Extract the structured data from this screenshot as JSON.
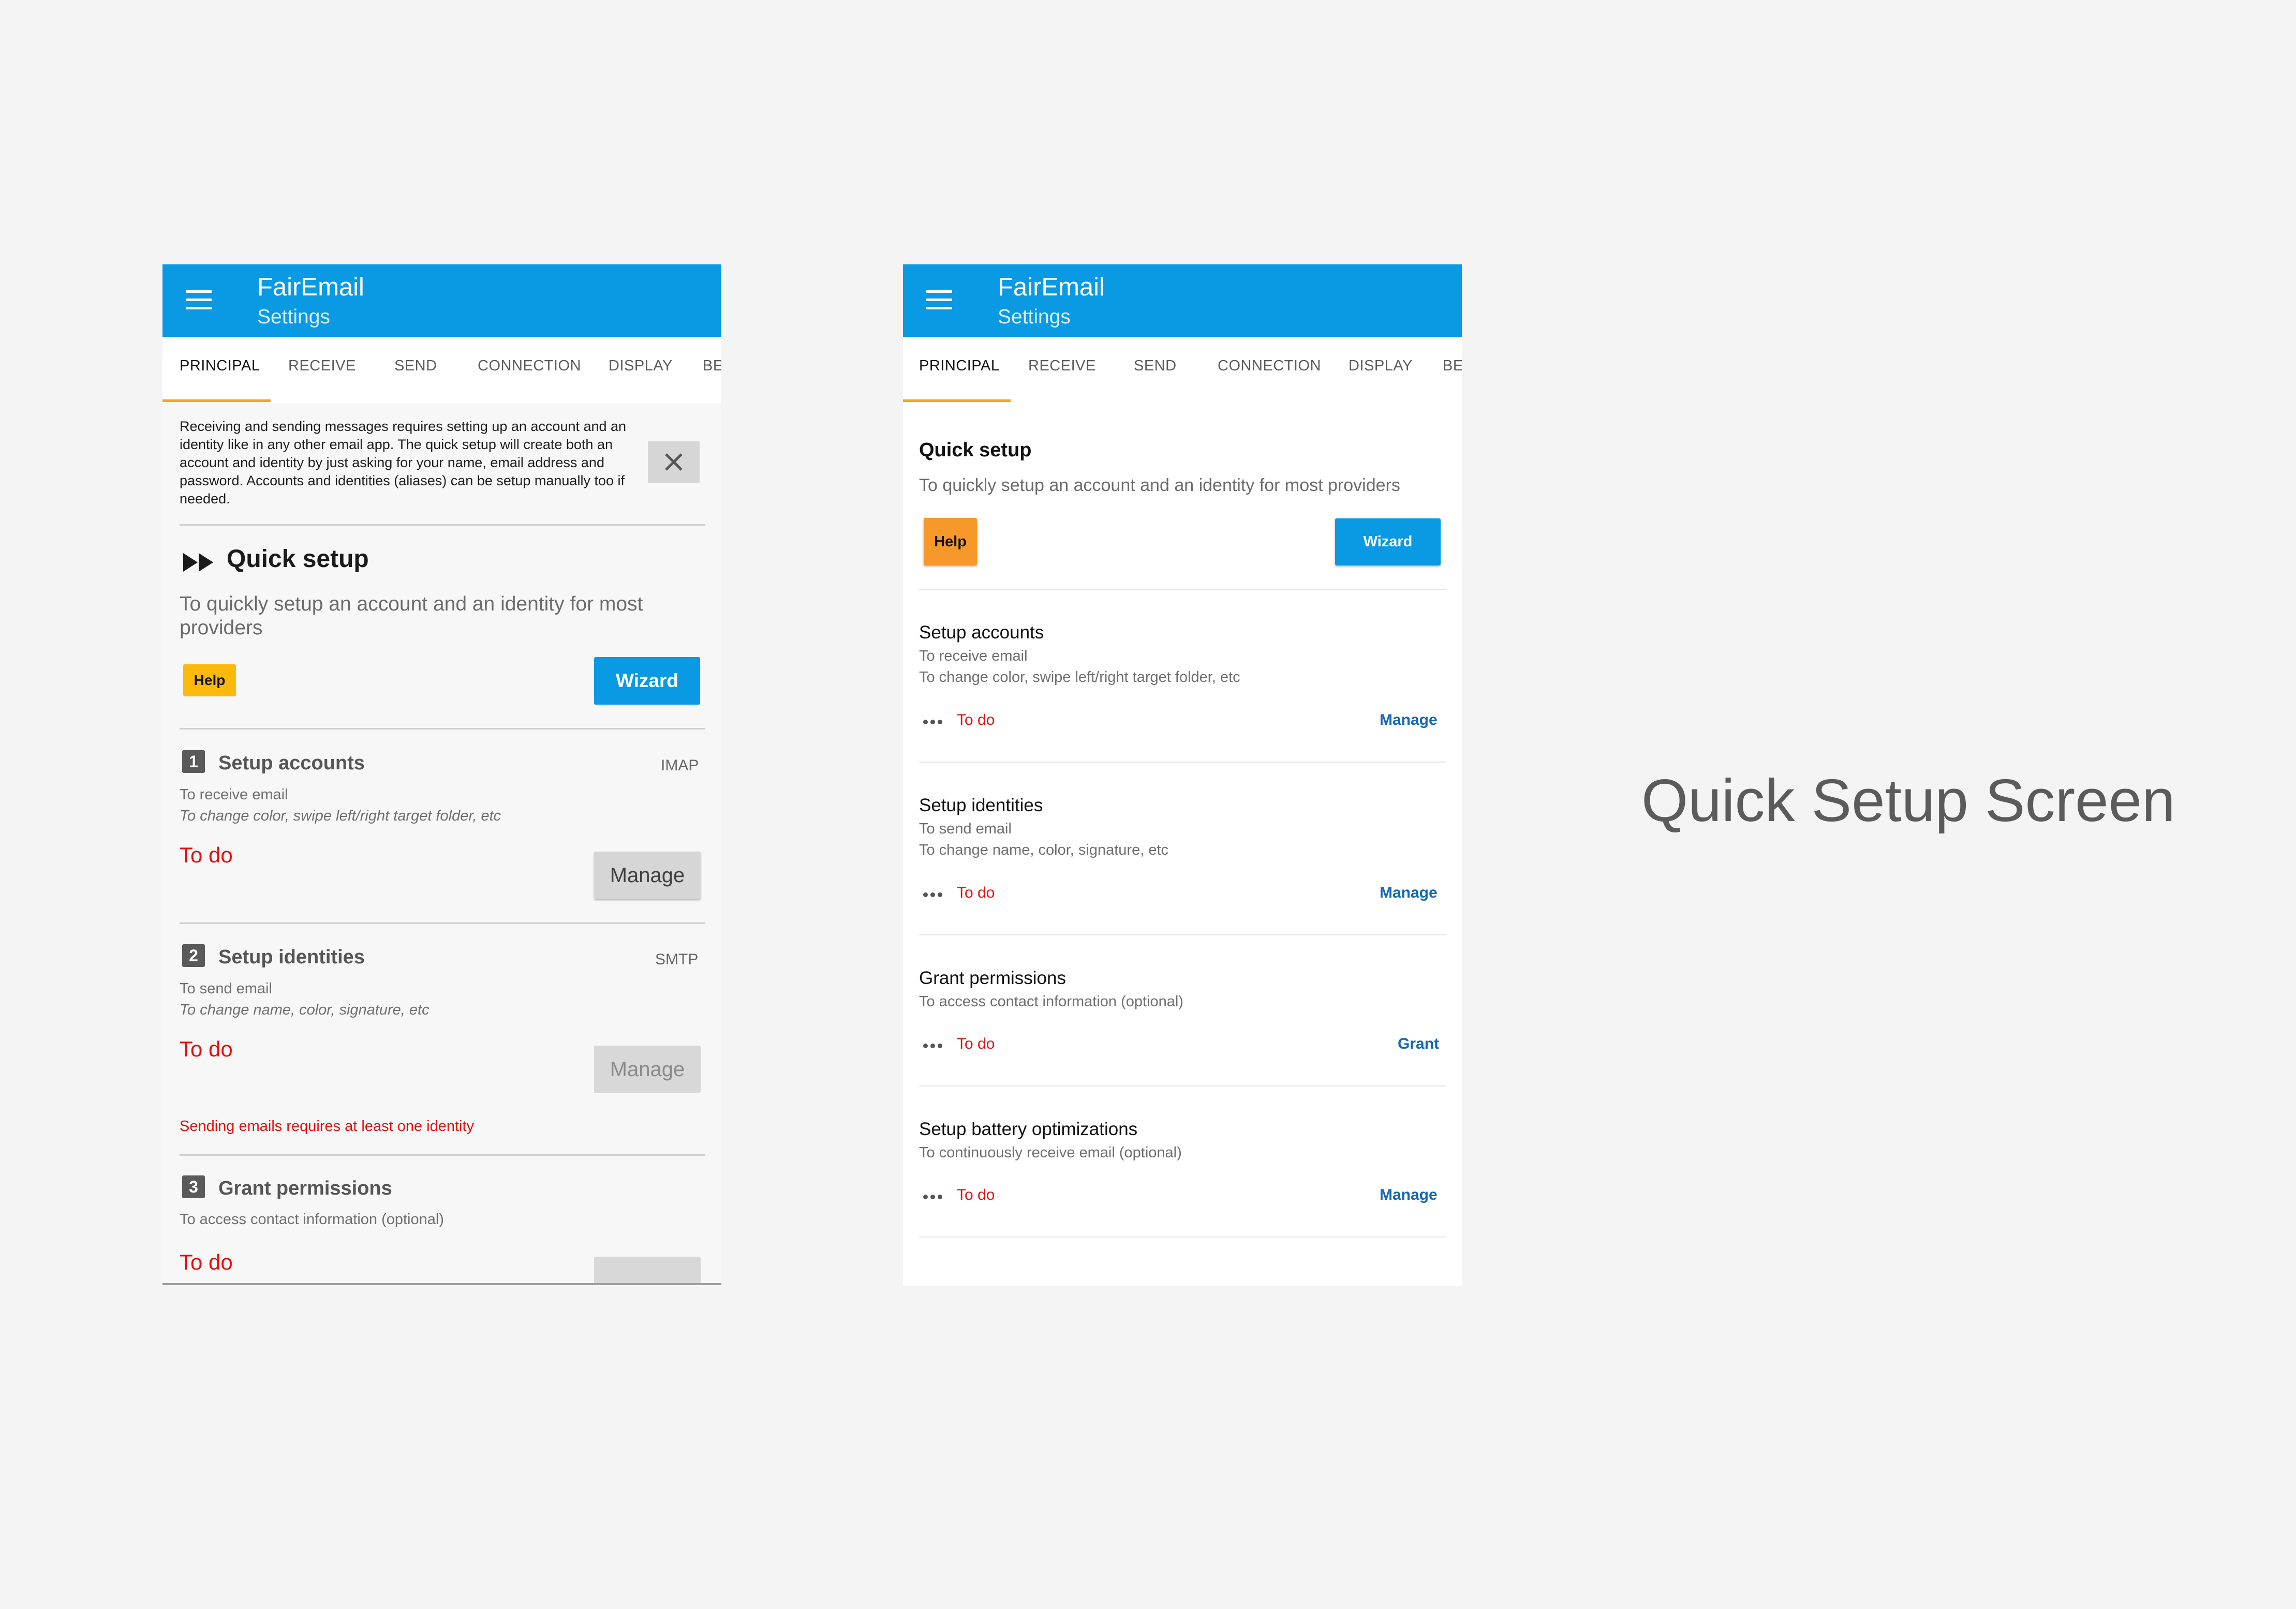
{
  "caption": "Quick Setup Screen",
  "colors": {
    "appbar": "#0a9ae4",
    "accent_underline": "#f4a623",
    "todo": "#e20e0e",
    "action_link": "#1668b4",
    "help_left": "#fbb90a",
    "help_right": "#f7992a"
  },
  "left": {
    "app_title": "FairEmail",
    "app_subtitle": "Settings",
    "tabs": [
      "PRINCIPAL",
      "RECEIVE",
      "SEND",
      "CONNECTION",
      "DISPLAY",
      "BE"
    ],
    "info": "Receiving and sending messages requires setting up an account and an identity like in any other email app. The quick setup will create both an account and identity by just asking for your name, email address and password. Accounts and identities (aliases) can be setup manually too if needed.",
    "quick_setup": {
      "title": "Quick setup",
      "subtitle": "To quickly setup an account and an identity for most providers",
      "help": "Help",
      "wizard": "Wizard"
    },
    "steps": [
      {
        "num": "1",
        "title": "Setup accounts",
        "protocol": "IMAP",
        "line1": "To receive email",
        "line2": "To change color, swipe left/right target folder, etc",
        "status": "To do",
        "action": "Manage"
      },
      {
        "num": "2",
        "title": "Setup identities",
        "protocol": "SMTP",
        "line1": "To send email",
        "line2": "To change name, color, signature, etc",
        "status": "To do",
        "action": "Manage"
      },
      {
        "num": "3",
        "title": "Grant permissions",
        "line1": "To access contact information (optional)",
        "status": "To do"
      }
    ],
    "warning": "Sending emails requires at least one identity"
  },
  "right": {
    "app_title": "FairEmail",
    "app_subtitle": "Settings",
    "tabs": [
      "PRINCIPAL",
      "RECEIVE",
      "SEND",
      "CONNECTION",
      "DISPLAY",
      "BE"
    ],
    "quick_setup": {
      "title": "Quick setup",
      "subtitle": "To quickly setup an account and an identity for most providers",
      "help": "Help",
      "wizard": "Wizard"
    },
    "steps": [
      {
        "title": "Setup accounts",
        "line1": "To receive email",
        "line2": "To change color, swipe left/right target folder, etc",
        "status": "To do",
        "action": "Manage"
      },
      {
        "title": "Setup identities",
        "line1": "To send email",
        "line2": "To change name, color, signature, etc",
        "status": "To do",
        "action": "Manage"
      },
      {
        "title": "Grant permissions",
        "line1": "To access contact information (optional)",
        "status": "To do",
        "action": "Grant"
      },
      {
        "title": "Setup battery optimizations",
        "line1": "To continuously receive email (optional)",
        "status": "To do",
        "action": "Manage"
      }
    ]
  }
}
